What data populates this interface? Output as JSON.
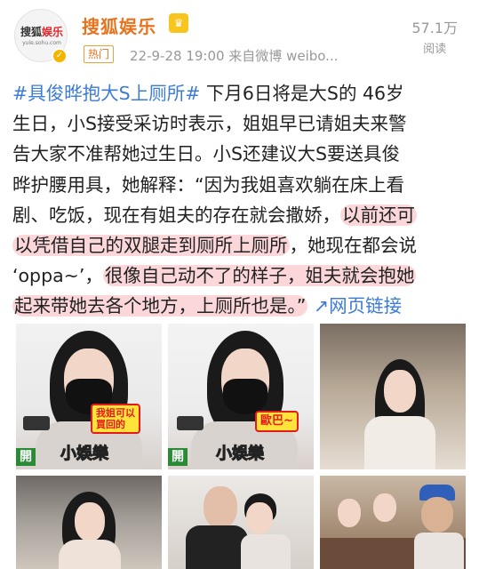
{
  "account": {
    "avatar_logo_part1": "搜狐",
    "avatar_logo_part2": "娱乐",
    "avatar_url": "yule.sohu.com",
    "name": "搜狐娱乐",
    "vip_badge": "👑",
    "hot_label": "热门",
    "meta": "22-9-28 19:00  来自微博 weibo...",
    "views_count": "57.1万",
    "views_label": "阅读"
  },
  "post": {
    "lines": [
      [
        {
          "text": "#具俊晔抱大S上厕所#",
          "style": "link"
        },
        {
          "text": " 下月6日将是大S的 46岁",
          "style": "plain"
        }
      ],
      [
        {
          "text": "生日，小S接受采访时表示，姐姐早已请姐夫来警",
          "style": "plain"
        }
      ],
      [
        {
          "text": "告大家不准帮她过生日。小S还建议大S要送具俊",
          "style": "plain"
        }
      ],
      [
        {
          "text": "晔护腰用具，她解释：“因为我姐喜欢躺在床上看",
          "style": "plain"
        }
      ],
      [
        {
          "text": "剧、吃饭，现在有姐夫的存在就会撒娇，",
          "style": "plain"
        },
        {
          "text": "以前还可",
          "style": "highlight"
        }
      ],
      [
        {
          "text": "以凭借自己的双腿走到厕所上厕所",
          "style": "highlight"
        },
        {
          "text": "，她现在都会说",
          "style": "plain"
        }
      ],
      [
        {
          "text": "‘oppa~’，",
          "style": "plain"
        },
        {
          "text": "很像自己动不了的样子，姐夫就会抱她",
          "style": "highlight"
        }
      ],
      [
        {
          "text": "起来带她去各个地方，上厕所也是。”",
          "style": "highlight"
        },
        {
          "text": " ↗",
          "style": "link"
        },
        {
          "text": "网页链接",
          "style": "link"
        }
      ]
    ]
  },
  "photos": {
    "sticker_1": "我姐可以\n買回的",
    "sticker_2": "歐巴~",
    "brand_1": "小娛樂",
    "brand_2": "小娛樂",
    "side_1": "開",
    "side_2": "開",
    "alt": [
      "photo-masked-woman-1",
      "photo-masked-woman-2",
      "photo-woman-phone",
      "photo-woman-dress",
      "photo-couple-kiss",
      "photo-group-dinner"
    ]
  },
  "colors": {
    "account_name": "#e9721d",
    "link": "#3c7bd6",
    "highlight": "#f7b6ba",
    "meta_gray": "#999999"
  }
}
